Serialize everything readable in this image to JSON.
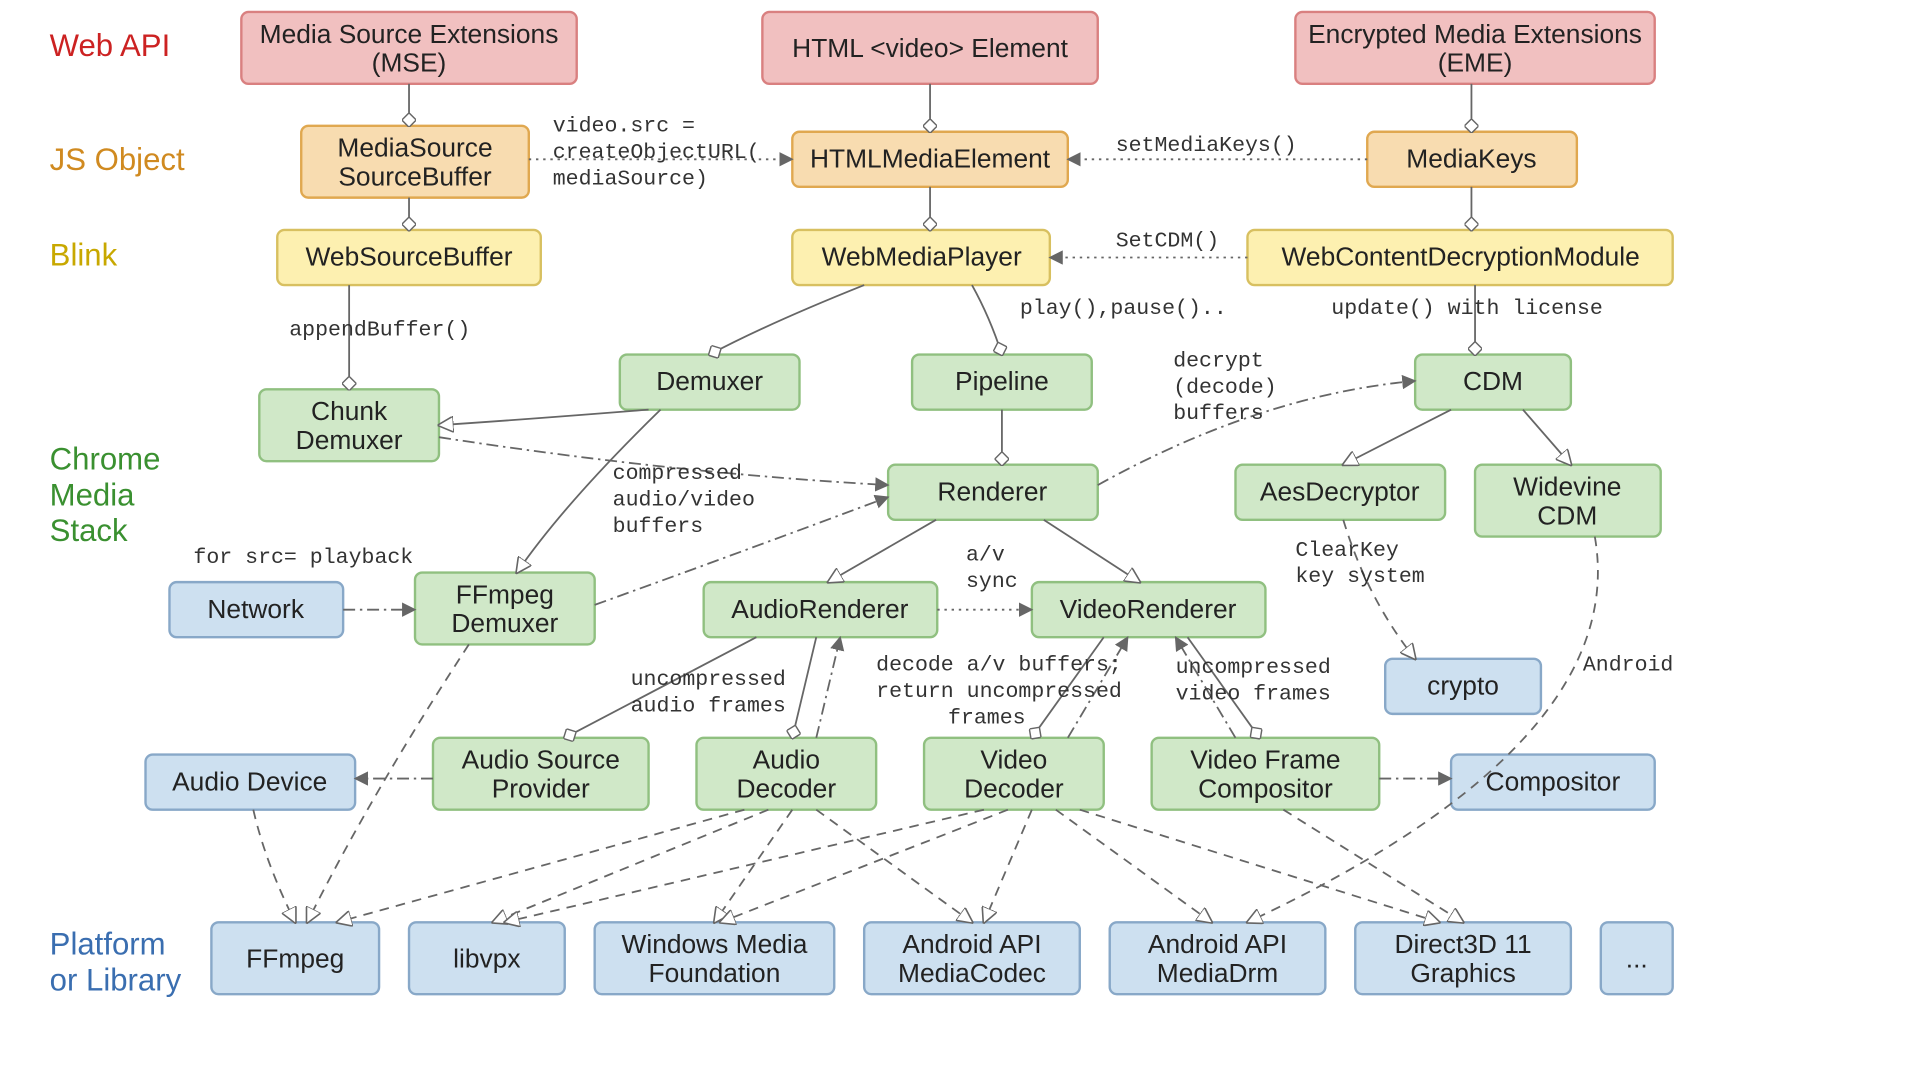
{
  "layers": {
    "webapi": {
      "label": "Web API",
      "color": "#cc2222"
    },
    "jsobj": {
      "label": "JS Object",
      "color": "#d08a20"
    },
    "blink": {
      "label": "Blink",
      "color": "#c8a800"
    },
    "cms1": {
      "label": "Chrome",
      "color": "#3a9030"
    },
    "cms2": {
      "label": "Media",
      "color": "#3a9030"
    },
    "cms3": {
      "label": "Stack",
      "color": "#3a9030"
    },
    "plat1": {
      "label": "Platform",
      "color": "#3a6eb0"
    },
    "plat2": {
      "label": "or Library",
      "color": "#3a6eb0"
    }
  },
  "boxes": {
    "mse": {
      "l1": "Media Source Extensions",
      "l2": "(MSE)"
    },
    "video": {
      "l1": "HTML <video> Element"
    },
    "eme": {
      "l1": "Encrypted Media Extensions",
      "l2": "(EME)"
    },
    "mssb": {
      "l1": "MediaSource",
      "l2": "SourceBuffer"
    },
    "hme": {
      "l1": "HTMLMediaElement"
    },
    "mk": {
      "l1": "MediaKeys"
    },
    "wsb": {
      "l1": "WebSourceBuffer"
    },
    "wmp": {
      "l1": "WebMediaPlayer"
    },
    "wcdm": {
      "l1": "WebContentDecryptionModule"
    },
    "chunkdem": {
      "l1": "Chunk",
      "l2": "Demuxer"
    },
    "demuxer": {
      "l1": "Demuxer"
    },
    "pipeline": {
      "l1": "Pipeline"
    },
    "cdm": {
      "l1": "CDM"
    },
    "renderer": {
      "l1": "Renderer"
    },
    "aesdec": {
      "l1": "AesDecryptor"
    },
    "wvcdm": {
      "l1": "Widevine",
      "l2": "CDM"
    },
    "network": {
      "l1": "Network"
    },
    "ffdem": {
      "l1": "FFmpeg",
      "l2": "Demuxer"
    },
    "arender": {
      "l1": "AudioRenderer"
    },
    "vrender": {
      "l1": "VideoRenderer"
    },
    "crypto": {
      "l1": "crypto"
    },
    "adev": {
      "l1": "Audio Device"
    },
    "asp": {
      "l1": "Audio Source",
      "l2": "Provider"
    },
    "adec": {
      "l1": "Audio",
      "l2": "Decoder"
    },
    "vdec": {
      "l1": "Video",
      "l2": "Decoder"
    },
    "vfc": {
      "l1": "Video Frame",
      "l2": "Compositor"
    },
    "comp": {
      "l1": "Compositor"
    },
    "ffmpeg": {
      "l1": "FFmpeg"
    },
    "libvpx": {
      "l1": "libvpx"
    },
    "wmf": {
      "l1": "Windows Media",
      "l2": "Foundation"
    },
    "amc": {
      "l1": "Android API",
      "l2": "MediaCodec"
    },
    "adrm": {
      "l1": "Android API",
      "l2": "MediaDrm"
    },
    "d3d": {
      "l1": "Direct3D 11",
      "l2": "Graphics"
    },
    "more": {
      "l1": "..."
    }
  },
  "ann": {
    "createurl1": "video.src =",
    "createurl2": "createObjectURL(",
    "createurl3": "mediaSource)",
    "setmk": "setMediaKeys()",
    "setcdm": "SetCDM()",
    "append": "appendBuffer()",
    "playpause": "play(),pause()..",
    "update": "update() with license",
    "decrypt1": "decrypt",
    "decrypt2": "(decode)",
    "decrypt3": "buffers",
    "compav1": "compressed",
    "compav2": "audio/video",
    "compav3": "buffers",
    "srcplay": "for src= playback",
    "avsync1": "a/v",
    "avsync2": "sync",
    "clearkey1": "ClearKey",
    "clearkey2": "key system",
    "uaf1": "uncompressed",
    "uaf2": "audio frames",
    "decret1": "decode a/v buffers;",
    "decret2": "return uncompressed",
    "decret3": "frames",
    "uvf1": "uncompressed",
    "uvf2": "video frames",
    "android": "Android"
  }
}
